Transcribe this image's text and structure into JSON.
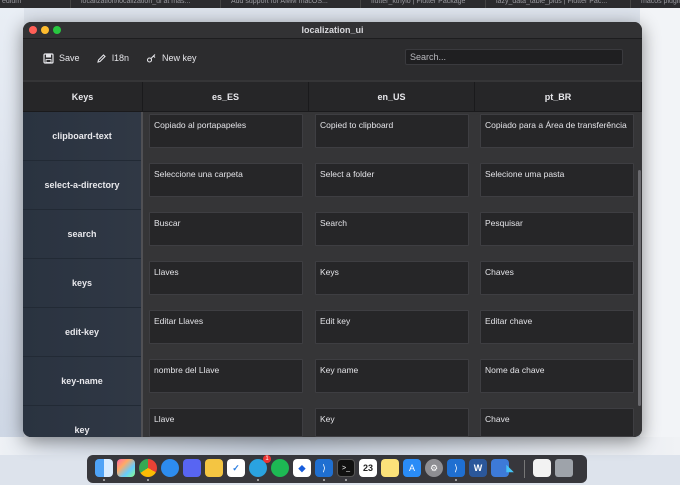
{
  "background_tabs": [
    {
      "label": "edium"
    },
    {
      "label": "localization/localization_ui at mas..."
    },
    {
      "label": "Add support for AMM macOS..."
    },
    {
      "label": "flutter_kthylo | Flutter Package"
    },
    {
      "label": "lazy_data_table_plus | Flutter Pac..."
    },
    {
      "label": "macos plugin"
    }
  ],
  "window": {
    "title": "localization_ui"
  },
  "toolbar": {
    "save_label": "Save",
    "i18n_label": "l18n",
    "new_key_label": "New key",
    "search_placeholder": "Search..."
  },
  "table": {
    "key_header": "Keys",
    "languages": [
      "es_ES",
      "en_US",
      "pt_BR"
    ],
    "rows": [
      {
        "key": "clipboard-text",
        "values": [
          "Copiado al portapapeles",
          "Copied to clipboard",
          "Copiado para a Área de transferência"
        ]
      },
      {
        "key": "select-a-directory",
        "values": [
          "Seleccione una carpeta",
          "Select a folder",
          "Selecione uma pasta"
        ]
      },
      {
        "key": "search",
        "values": [
          "Buscar",
          "Search",
          "Pesquisar"
        ]
      },
      {
        "key": "keys",
        "values": [
          "Llaves",
          "Keys",
          "Chaves"
        ]
      },
      {
        "key": "edit-key",
        "values": [
          "Editar Llaves",
          "Edit key",
          "Editar chave"
        ]
      },
      {
        "key": "key-name",
        "values": [
          "nombre del Llave",
          "Key name",
          "Nome da chave"
        ]
      },
      {
        "key": "key",
        "values": [
          "Llave",
          "Key",
          "Chave"
        ]
      }
    ]
  },
  "dock": {
    "calendar_day": "23",
    "telegram_badge": "1",
    "items": [
      "finder-icon",
      "launchpad-icon",
      "chrome-icon",
      "safari-icon",
      "discord-icon",
      "tasks-icon",
      "telegram-icon",
      "spotify-icon",
      "bitwarden-icon",
      "vscode-icon",
      "terminal-icon",
      "calendar-icon",
      "notes-icon",
      "app-store-icon",
      "settings-icon",
      "vscode-insiders-icon",
      "word-icon",
      "preview-icon",
      "flutter-icon",
      "document-icon",
      "trash-icon"
    ]
  },
  "colors": {
    "window_bg": "#2c2c2e",
    "cell_bg": "#262628",
    "key_column_bg": "#2a3340",
    "traffic_red": "#ff5f57",
    "traffic_yellow": "#febc2e",
    "traffic_green": "#28c840"
  }
}
